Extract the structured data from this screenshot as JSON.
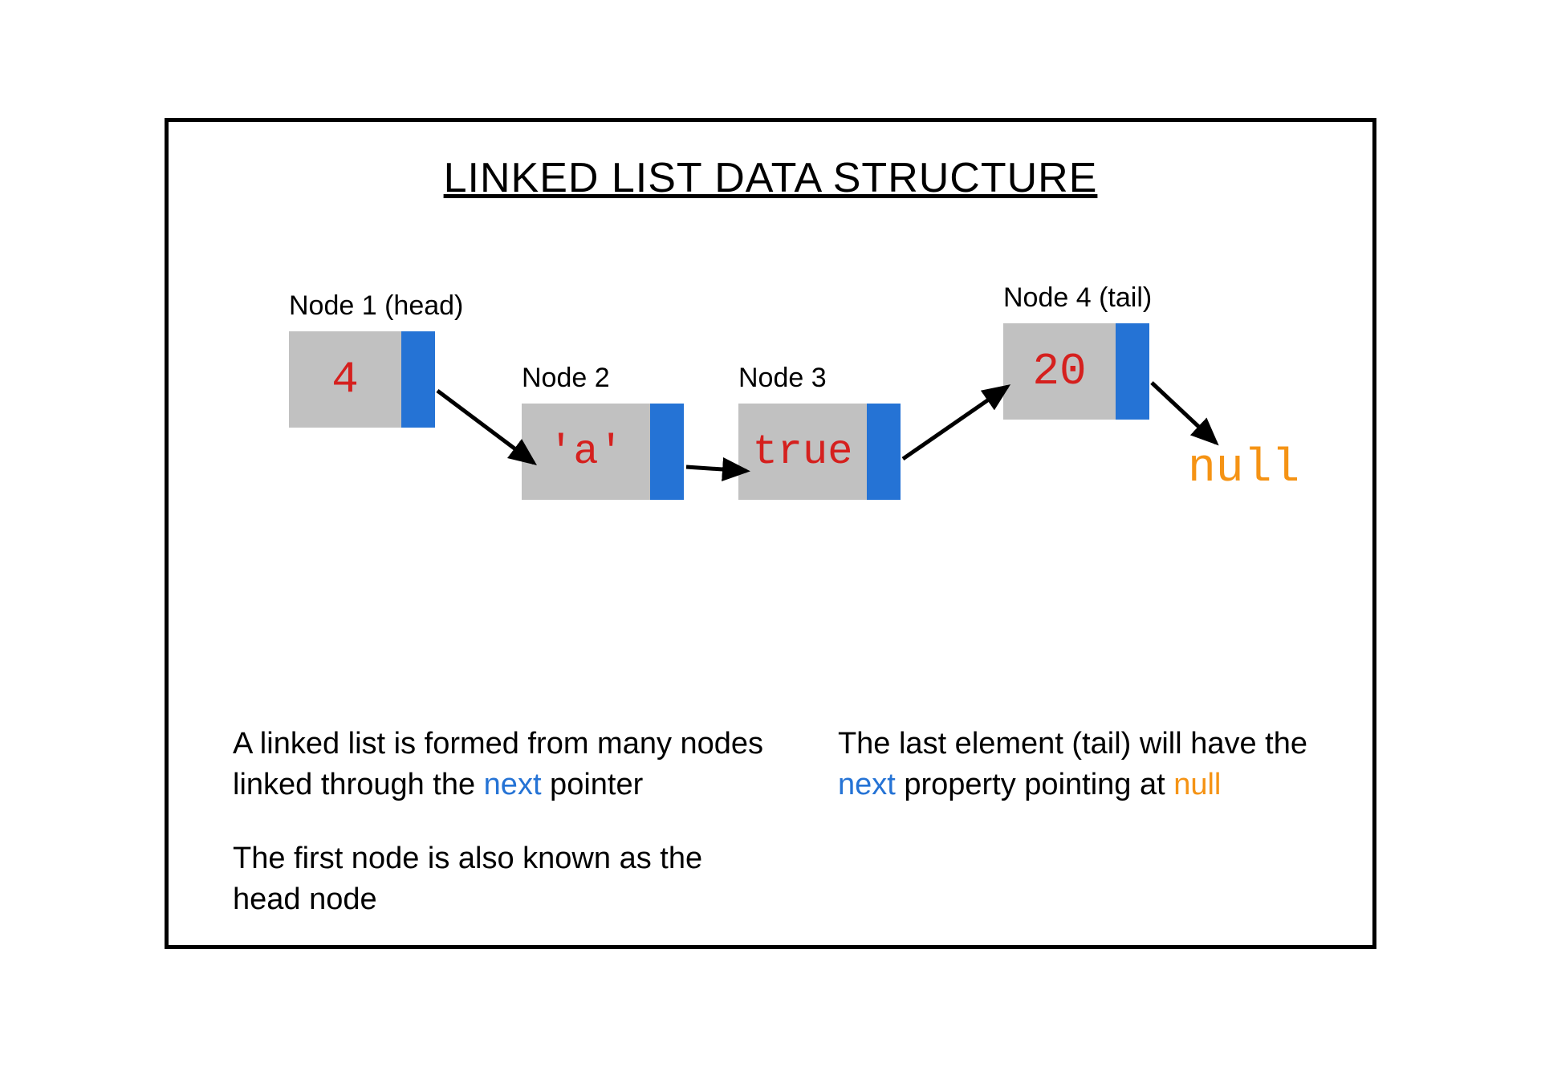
{
  "title": "LINKED LIST DATA STRUCTURE",
  "nodes": [
    {
      "label": "Node 1 (head)",
      "value": "4"
    },
    {
      "label": "Node 2",
      "value": "'a'"
    },
    {
      "label": "Node 3",
      "value": "true"
    },
    {
      "label": "Node 4 (tail)",
      "value": "20"
    }
  ],
  "null_text": "null",
  "desc": {
    "left1_a": "A linked list is formed from many nodes linked through the ",
    "left1_b": "next",
    "left1_c": " pointer",
    "left2": "The first node is also known as the head node",
    "right_a": "The last element (tail) will have the ",
    "right_b": "next",
    "right_c": " property pointing at ",
    "right_d": "null"
  },
  "colors": {
    "node_fill": "#c1c1c1",
    "pointer_fill": "#2573d5",
    "value_color": "#d5201e",
    "null_color": "#f59314",
    "next_color": "#2573d5"
  }
}
